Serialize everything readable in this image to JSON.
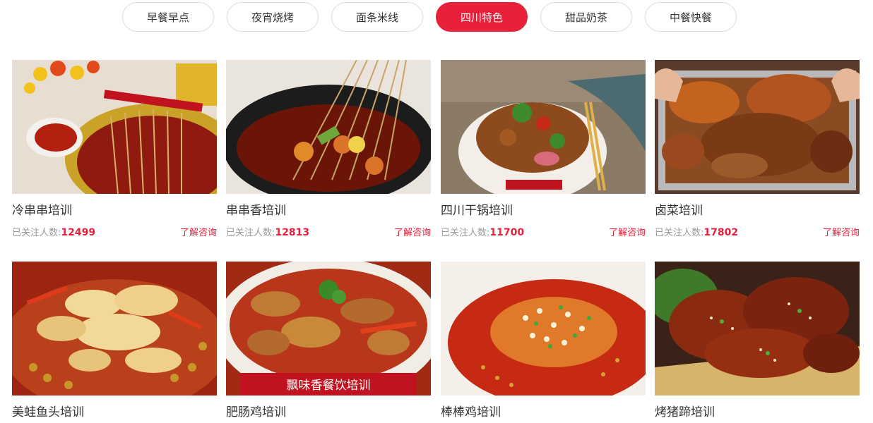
{
  "tabs": [
    {
      "label": "早餐早点",
      "active": false
    },
    {
      "label": "夜宵烧烤",
      "active": false
    },
    {
      "label": "面条米线",
      "active": false
    },
    {
      "label": "四川特色",
      "active": true
    },
    {
      "label": "甜品奶茶",
      "active": false
    },
    {
      "label": "中餐快餐",
      "active": false
    }
  ],
  "follow_label": "已关注人数:",
  "consult_label": "了解咨询",
  "cards": [
    {
      "title": "冷串串培训",
      "count": "12499"
    },
    {
      "title": "串串香培训",
      "count": "12813"
    },
    {
      "title": "四川干锅培训",
      "count": "11700"
    },
    {
      "title": "卤菜培训",
      "count": "17802"
    },
    {
      "title": "美蛙鱼头培训"
    },
    {
      "title": "肥肠鸡培训"
    },
    {
      "title": "棒棒鸡培训"
    },
    {
      "title": "烤猪蹄培训"
    }
  ],
  "image_banner_text": "飘味香餐饮培训",
  "colors": {
    "accent": "#e8203a",
    "muted": "#999999",
    "text": "#333333",
    "border": "#dcdcdc"
  }
}
